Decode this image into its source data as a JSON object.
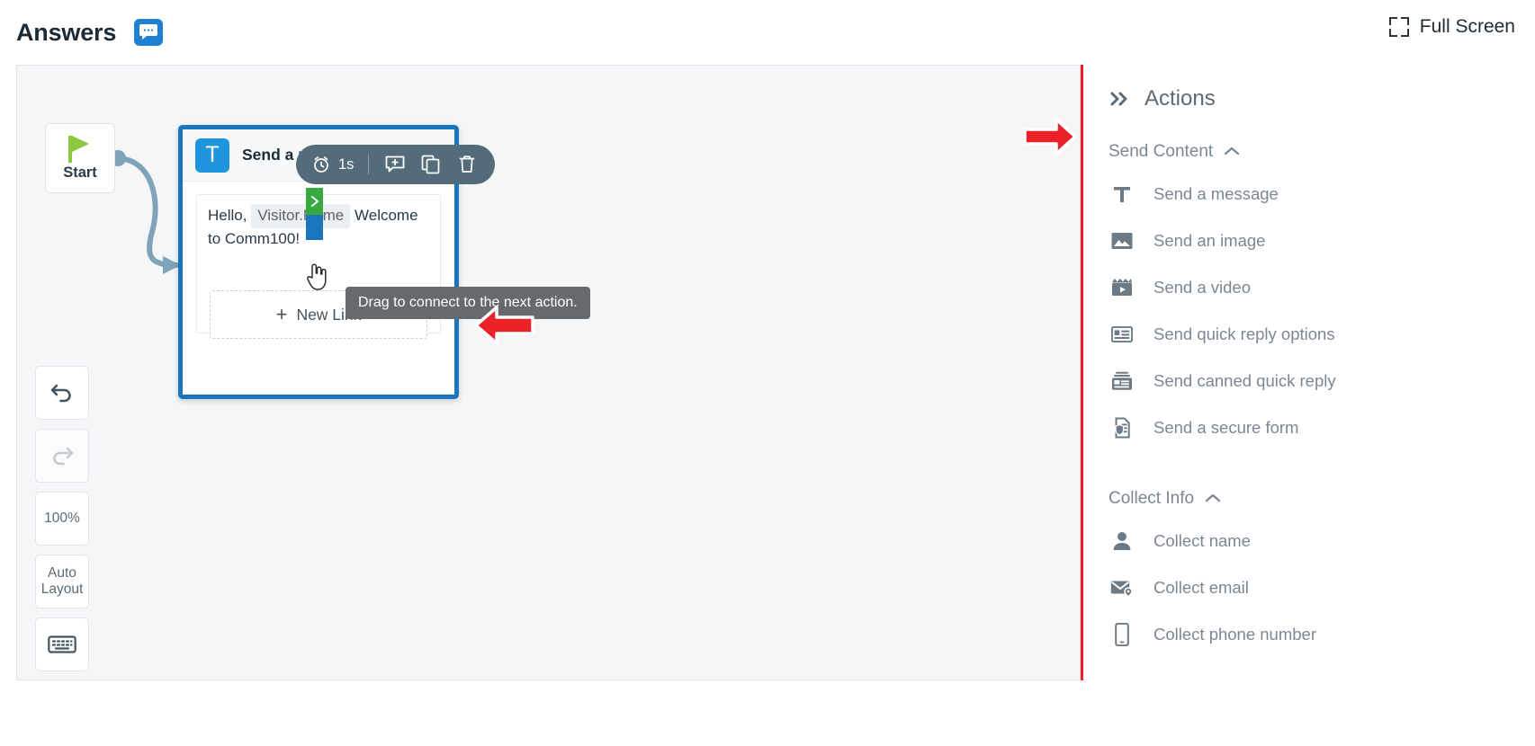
{
  "header": {
    "title": "Answers",
    "badge_icon": "chat-bubble-icon",
    "fullscreen_label": "Full Screen",
    "fullscreen_icon": "fullscreen-expand-icon"
  },
  "canvas": {
    "start_node": {
      "label": "Start",
      "icon": "green-flag-icon"
    },
    "node_toolbar": {
      "delay_value": "1s",
      "delay_icon": "alarm-clock-icon",
      "add_message_icon": "add-message-icon",
      "duplicate_icon": "copy-icon",
      "delete_icon": "trash-icon"
    },
    "message_node": {
      "icon": "text-message-t-icon",
      "title": "Send a message",
      "bubble_text_before": "Hello,",
      "bubble_token": "Visitor.Name",
      "bubble_text_after": "Welcome to Comm100!",
      "new_link_label": "New Link",
      "new_link_icon": "plus-icon",
      "out_port_icon": "chevron-right-icon"
    },
    "tooltip": "Drag to connect to the next action.",
    "annotations": [
      {
        "name": "red-arrow-pointing-to-actions-panel",
        "icon": "red-arrow-right-icon"
      },
      {
        "name": "red-arrow-pointing-to-connector-port",
        "icon": "red-arrow-left-icon"
      }
    ],
    "tools": [
      {
        "name": "undo-button",
        "label": "",
        "icon": "undo-icon",
        "disabled": false
      },
      {
        "name": "redo-button",
        "label": "",
        "icon": "redo-icon",
        "disabled": true
      },
      {
        "name": "zoom-level-button",
        "label": "100%",
        "icon": "",
        "disabled": false
      },
      {
        "name": "auto-layout-button",
        "label": "Auto Layout",
        "icon": "",
        "disabled": false
      },
      {
        "name": "keyboard-shortcuts-button",
        "label": "",
        "icon": "keyboard-icon",
        "disabled": false
      }
    ]
  },
  "actions_panel": {
    "title": "Actions",
    "collapse_icon": "chevron-double-right-icon",
    "groups": [
      {
        "label": "Send Content",
        "chevron": "chevron-up-icon",
        "items": [
          {
            "label": "Send a message",
            "icon": "text-t-icon"
          },
          {
            "label": "Send an image",
            "icon": "image-icon"
          },
          {
            "label": "Send a video",
            "icon": "video-clapper-icon"
          },
          {
            "label": "Send quick reply options",
            "icon": "quick-reply-card-icon"
          },
          {
            "label": "Send canned quick reply",
            "icon": "canned-reply-stack-icon"
          },
          {
            "label": "Send a secure form",
            "icon": "secure-form-shield-icon"
          }
        ]
      },
      {
        "label": "Collect Info",
        "chevron": "chevron-up-icon",
        "items": [
          {
            "label": "Collect name",
            "icon": "person-icon"
          },
          {
            "label": "Collect email",
            "icon": "envelope-pin-icon"
          },
          {
            "label": "Collect phone number",
            "icon": "mobile-phone-icon"
          }
        ]
      }
    ]
  },
  "colors": {
    "accent_blue": "#1a75bc",
    "icon_blue": "#1f95dd",
    "annotation_red": "#ee1c25",
    "port_green": "#36a93f",
    "flag_green": "#8cc63f",
    "toolbar_slate": "#546b7a"
  }
}
